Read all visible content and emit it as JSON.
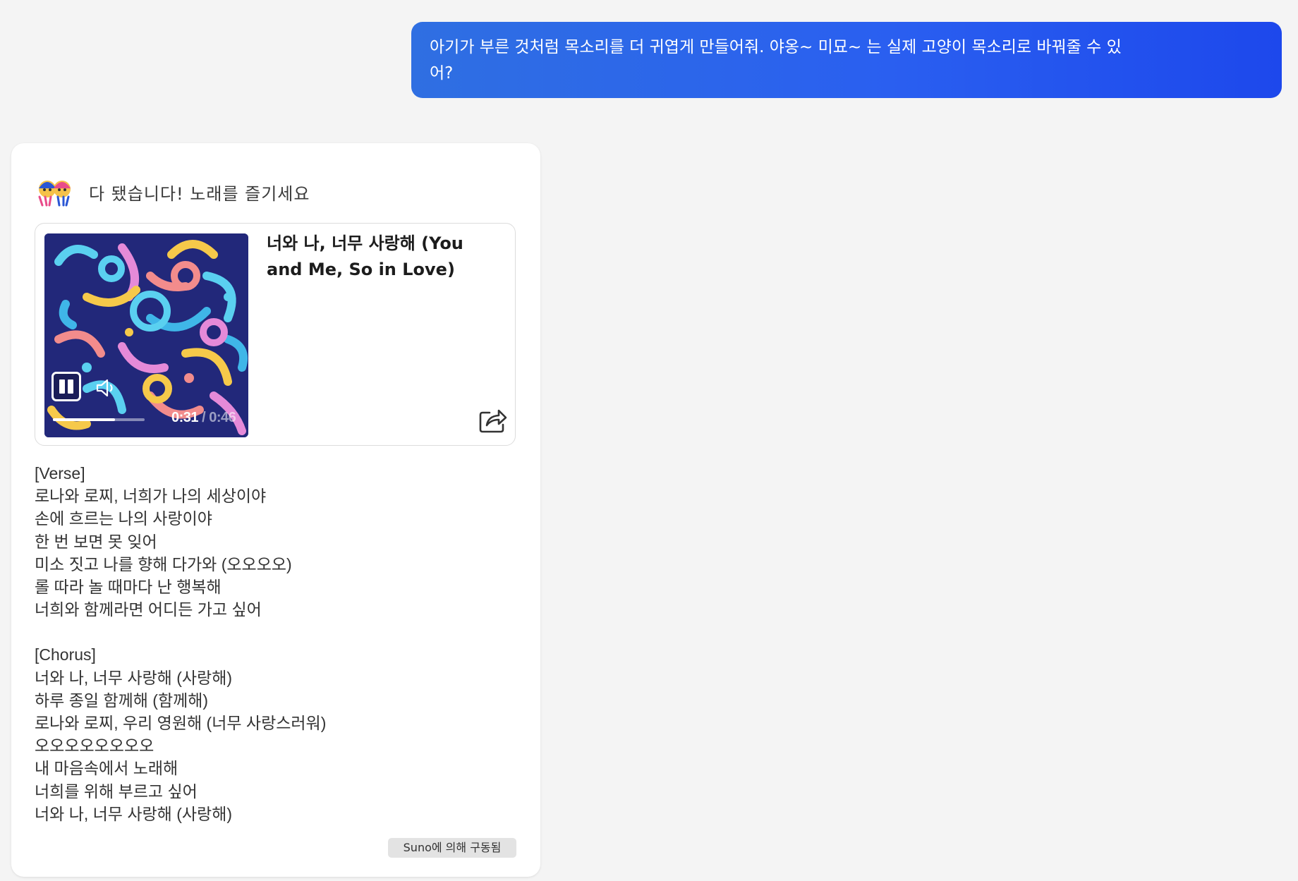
{
  "user_message": {
    "line1": "아기가 부른 것처럼 목소리를 더 귀엽게 만들어줘. 야옹~ 미묘~ 는 실제 고양이 목소리로 바꿔줄 수 있",
    "line2": "어?"
  },
  "bot_response": {
    "header_text": "다 됐습니다! 노래를 즐기세요",
    "song": {
      "title_line1": "너와 나, 너무 사랑해 (You",
      "title_line2": "and Me, So in Love)",
      "elapsed": "0:31",
      "separator": "/",
      "duration": "0:46",
      "progress_fraction": 0.674
    },
    "lyrics": [
      {
        "lines": [
          "[Verse]",
          "로나와 로찌, 너희가 나의 세상이야",
          "손에 흐르는 나의 사랑이야",
          "한 번 보면 못 잊어",
          "미소 짓고 나를 향해 다가와 (오오오오)",
          "롤 따라 놀 때마다 난 행복해",
          "너희와 함께라면 어디든 가고 싶어"
        ]
      },
      {
        "lines": [
          "[Chorus]",
          "너와 나, 너무 사랑해 (사랑해)",
          "하루 종일 함께해 (함께해)",
          "로나와 로찌, 우리 영원해 (너무 사랑스러워)",
          "오오오오오오오오",
          "내 마음속에서 노래해",
          "너희를 위해 부르고 싶어",
          "너와 나, 너무 사랑해 (사랑해)"
        ]
      }
    ],
    "powered_by": "Suno에 의해 구동됨"
  },
  "icons": {
    "avatar": "singing-characters-icon",
    "pause": "pause-icon",
    "volume": "speaker-icon",
    "share": "share-icon"
  },
  "colors": {
    "page_background": "#f4f4f4",
    "user_bubble_start": "#2f6fe2",
    "user_bubble_end": "#1d48ec",
    "card_background": "#ffffff",
    "artwork_background": "#22287a",
    "badge_background": "#e3e3e3"
  }
}
